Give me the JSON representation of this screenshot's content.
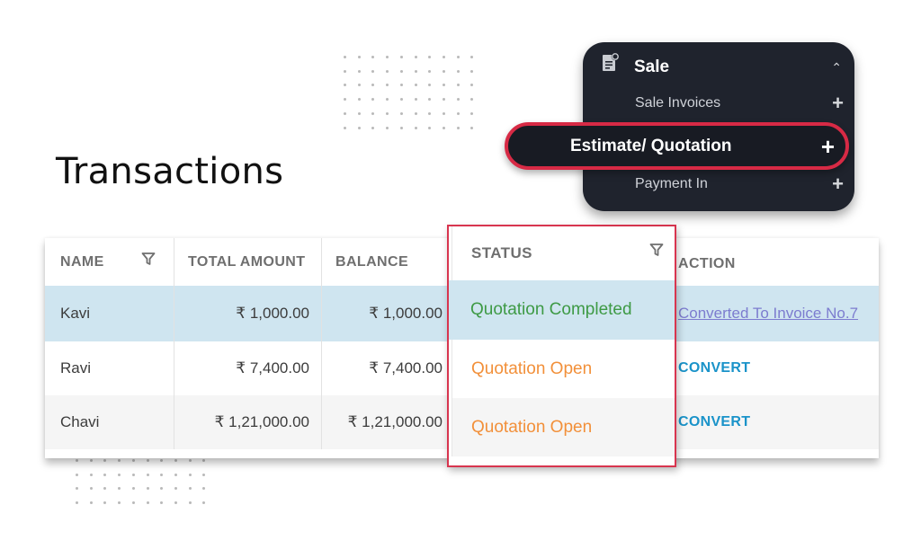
{
  "page": {
    "title": "Transactions"
  },
  "menu": {
    "section": {
      "label": "Sale",
      "icon": "sale-document-icon",
      "expanded": true
    },
    "items": [
      {
        "label": "Sale Invoices",
        "action_icon": "plus-icon"
      },
      {
        "label": "Estimate/ Quotation",
        "action_icon": "plus-icon",
        "highlighted": true
      },
      {
        "label": "Payment In",
        "action_icon": "plus-icon"
      }
    ]
  },
  "table": {
    "columns": [
      {
        "label": "NAME",
        "filter": true
      },
      {
        "label": "TOTAL AMOUNT",
        "filter": false
      },
      {
        "label": "BALANCE",
        "filter": false
      },
      {
        "label": "STATUS",
        "filter": true
      },
      {
        "label": "ACTION",
        "filter": false
      }
    ],
    "rows": [
      {
        "name": "Kavi",
        "total": "₹ 1,000.00",
        "balance": "₹ 1,000.00",
        "status": "Quotation Completed",
        "action": "Converted To Invoice No.7"
      },
      {
        "name": "Ravi",
        "total": "₹ 7,400.00",
        "balance": "₹ 7,400.00",
        "status": "Quotation Open",
        "action": "CONVERT"
      },
      {
        "name": "Chavi",
        "total": "₹ 1,21,000.00",
        "balance": "₹ 1,21,000.00",
        "status": "Quotation Open",
        "action": "CONVERT"
      }
    ]
  },
  "colors": {
    "completed": "#3e9a45",
    "open": "#f2903a",
    "convert": "#1a93c9",
    "link": "#7c7ccf",
    "highlight_border": "#d72a45",
    "selected_row": "#cfe5f0",
    "menu_bg": "#1f232d"
  }
}
